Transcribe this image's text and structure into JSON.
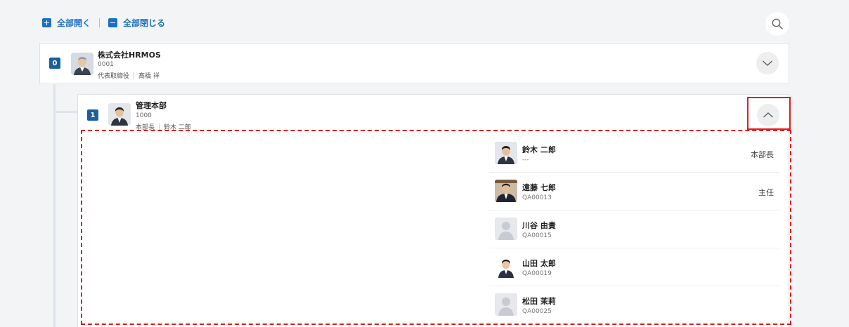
{
  "toolbar": {
    "expand_all": "全部開く",
    "collapse_all": "全部閉じる"
  },
  "icons": {
    "search": "search-icon",
    "expand": "plus-square-icon",
    "collapse": "minus-square-icon",
    "chevron_down": "chevron-down-icon",
    "chevron_up": "chevron-up-icon"
  },
  "colors": {
    "accent": "#1b6fc2",
    "level_badge": "#1b5e9e",
    "highlight": "#e01e1e",
    "background": "#f3f4f5"
  },
  "org_root": {
    "level": "0",
    "name": "株式会社HRMOS",
    "code": "0001",
    "leader_title": "代表取締役",
    "leader_name": "髙橋 祥"
  },
  "org_child": {
    "level": "1",
    "name": "管理本部",
    "code": "1000",
    "leader_title": "本部長",
    "leader_name": "鈴木 二郎"
  },
  "members": [
    {
      "name": "鈴木 二郎",
      "code": "---",
      "position": "本部長"
    },
    {
      "name": "遠藤 七郎",
      "code": "QA00013",
      "position": "主任"
    },
    {
      "name": "川谷 由貴",
      "code": "QA00015",
      "position": ""
    },
    {
      "name": "山田 太郎",
      "code": "QA00019",
      "position": ""
    },
    {
      "name": "松田 茉莉",
      "code": "QA00025",
      "position": ""
    }
  ]
}
